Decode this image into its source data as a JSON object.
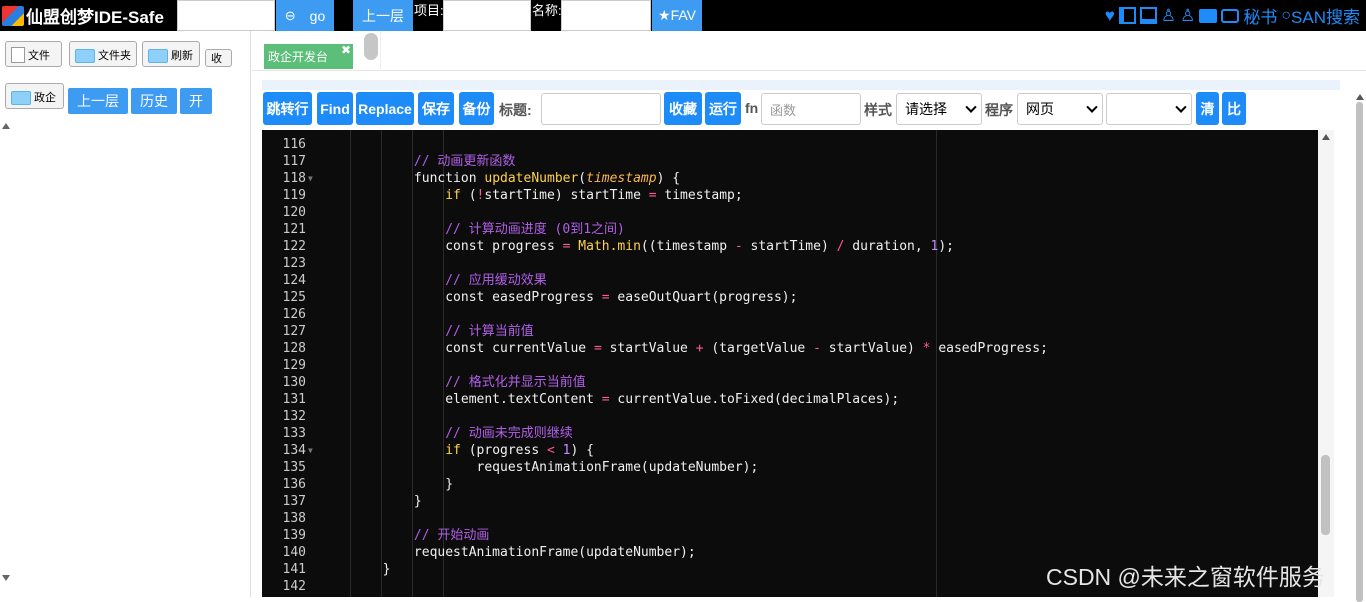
{
  "app": {
    "title": "仙盟创梦IDE-Safe"
  },
  "topbar": {
    "go_label": "go",
    "up_label": "上一层",
    "project_label": "项目:",
    "name_label": "名称:",
    "fav_label": "★FAV",
    "secretary_label": "秘书",
    "san_search_label": "SAN搜索"
  },
  "left": {
    "file_label": "文件",
    "folder_label": "文件夹",
    "refresh_label": "刷新",
    "collapse_label": "收",
    "gov_label": "政企",
    "up_label": "上一层",
    "history_label": "历史",
    "open_label": "开"
  },
  "tabs": [
    {
      "label": "政企开发台"
    }
  ],
  "toolbar": {
    "jump_label": "跳转行",
    "find_label": "Find",
    "replace_label": "Replace",
    "save_label": "保存",
    "backup_label": "备份",
    "title_label": "标题:",
    "collect_label": "收藏",
    "run_label": "运行",
    "fn_label": "fn",
    "fn_placeholder": "函数",
    "style_label": "样式",
    "style_value": "请选择",
    "program_label": "程序",
    "program_value": "网页",
    "extra_value": "",
    "clear_label": "清",
    "compare_label": "比"
  },
  "code_lines": [
    {
      "n": "116",
      "fold": false,
      "html": ""
    },
    {
      "n": "117",
      "fold": false,
      "html": "            <span class='c-comment'>// 动画更新函数</span>"
    },
    {
      "n": "118",
      "fold": true,
      "html": "            function <span class='c-fn'>updateNumber</span>(<span class='c-arg'>timestamp</span>) {"
    },
    {
      "n": "119",
      "fold": false,
      "html": "                <span class='c-kw'>if</span> (<span class='c-op'>!</span>startTime) startTime <span class='c-op'>=</span> timestamp;"
    },
    {
      "n": "120",
      "fold": false,
      "html": ""
    },
    {
      "n": "121",
      "fold": false,
      "html": "                <span class='c-comment'>// 计算动画进度 (0到1之间)</span>"
    },
    {
      "n": "122",
      "fold": false,
      "html": "                const progress <span class='c-op'>=</span> <span class='c-fn'>Math.min</span>((timestamp <span class='c-op'>-</span> startTime) <span class='c-op'>/</span> duration, <span class='c-num'>1</span>);"
    },
    {
      "n": "123",
      "fold": false,
      "html": ""
    },
    {
      "n": "124",
      "fold": false,
      "html": "                <span class='c-comment'>// 应用缓动效果</span>"
    },
    {
      "n": "125",
      "fold": false,
      "html": "                const easedProgress <span class='c-op'>=</span> easeOutQuart(progress);"
    },
    {
      "n": "126",
      "fold": false,
      "html": ""
    },
    {
      "n": "127",
      "fold": false,
      "html": "                <span class='c-comment'>// 计算当前值</span>"
    },
    {
      "n": "128",
      "fold": false,
      "html": "                const currentValue <span class='c-op'>=</span> startValue <span class='c-op'>+</span> (targetValue <span class='c-op'>-</span> startValue) <span class='c-op'>*</span> easedProgress;"
    },
    {
      "n": "129",
      "fold": false,
      "html": ""
    },
    {
      "n": "130",
      "fold": false,
      "html": "                <span class='c-comment'>// 格式化并显示当前值</span>"
    },
    {
      "n": "131",
      "fold": false,
      "html": "                element.textContent <span class='c-op'>=</span> currentValue.toFixed(decimalPlaces);"
    },
    {
      "n": "132",
      "fold": false,
      "html": ""
    },
    {
      "n": "133",
      "fold": false,
      "html": "                <span class='c-comment'>// 动画未完成则继续</span>"
    },
    {
      "n": "134",
      "fold": true,
      "html": "                <span class='c-kw'>if</span> (progress <span class='c-op'>&lt;</span> <span class='c-num'>1</span>) {"
    },
    {
      "n": "135",
      "fold": false,
      "html": "                    requestAnimationFrame(updateNumber);"
    },
    {
      "n": "136",
      "fold": false,
      "html": "                }"
    },
    {
      "n": "137",
      "fold": false,
      "html": "            }"
    },
    {
      "n": "138",
      "fold": false,
      "html": ""
    },
    {
      "n": "139",
      "fold": false,
      "html": "            <span class='c-comment'>// 开始动画</span>"
    },
    {
      "n": "140",
      "fold": false,
      "html": "            requestAnimationFrame(updateNumber);"
    },
    {
      "n": "141",
      "fold": false,
      "html": "        }"
    },
    {
      "n": "142",
      "fold": false,
      "html": ""
    }
  ],
  "watermark": "CSDN @未来之窗软件服务",
  "colors": {
    "accent": "#1d8cf8",
    "tab": "#5bbf7a",
    "editor_bg": "#0c0c0c",
    "comment": "#b15fe8",
    "keyword": "#ffd24a",
    "operator": "#ff5b8a"
  }
}
